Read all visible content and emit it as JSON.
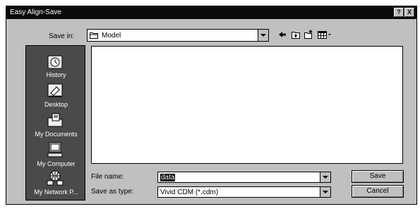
{
  "window": {
    "title": "Easy Align-Save",
    "help_btn": "?",
    "close_btn": "X"
  },
  "save_in": {
    "label": "Save in:",
    "value": "Model"
  },
  "toolbar": {
    "icons": [
      "back-icon",
      "up-folder-icon",
      "new-folder-icon",
      "view-menu-icon"
    ]
  },
  "sidebar": {
    "items": [
      {
        "label": "History",
        "icon": "history-icon"
      },
      {
        "label": "Desktop",
        "icon": "desktop-icon"
      },
      {
        "label": "My Documents",
        "icon": "my-documents-icon"
      },
      {
        "label": "My Computer",
        "icon": "my-computer-icon"
      },
      {
        "label": "My Network P...",
        "icon": "my-network-places-icon"
      }
    ]
  },
  "file_name": {
    "label": "File name:",
    "value": "data"
  },
  "save_as_type": {
    "label": "Save as type:",
    "value": "Vivid CDM (*.cdm)"
  },
  "buttons": {
    "save": "Save",
    "cancel": "Cancel"
  }
}
